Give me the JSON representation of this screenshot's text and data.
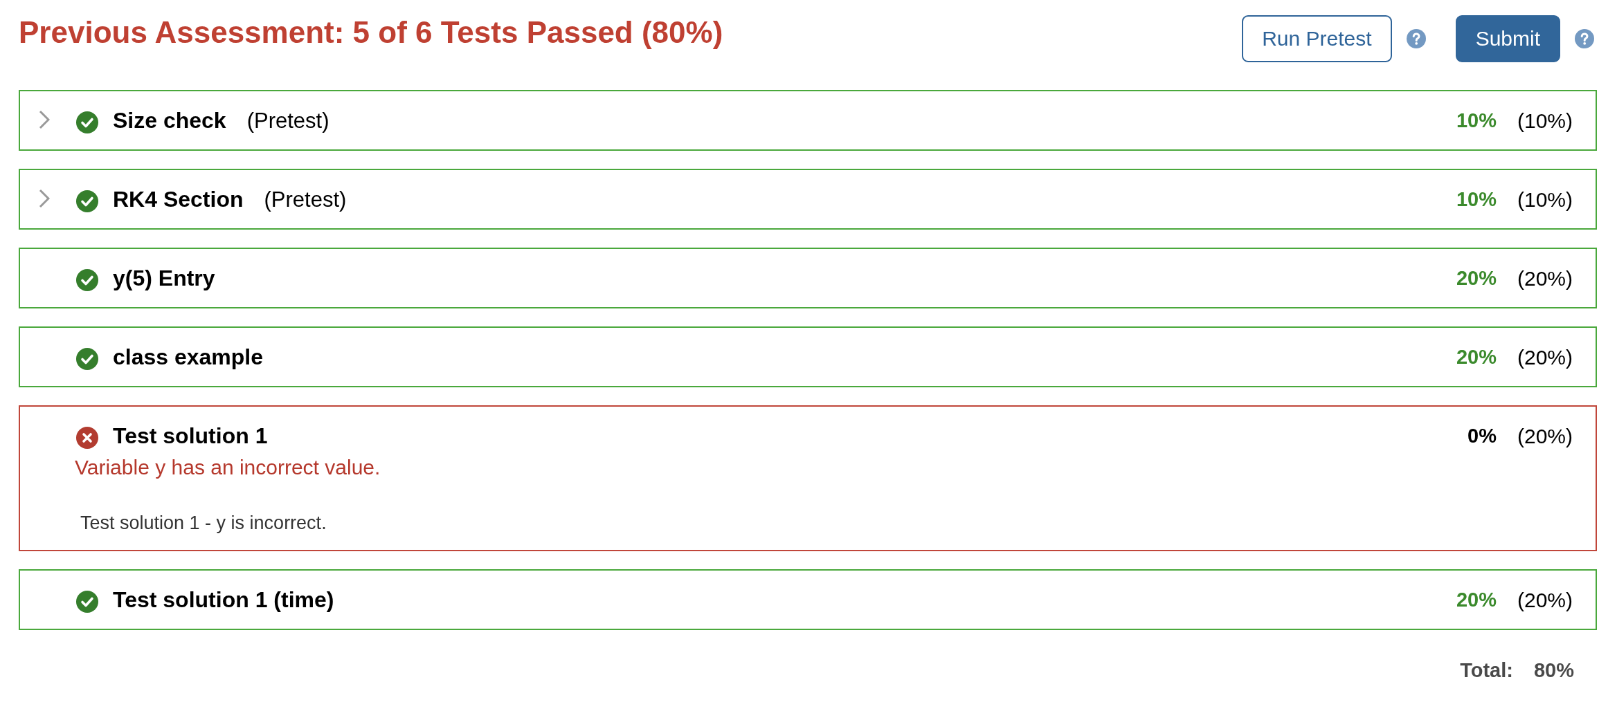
{
  "header": {
    "title": "Previous Assessment: 5 of 6 Tests Passed (80%)",
    "actions": [
      {
        "kind": "outline",
        "label": "Run Pretest",
        "help": true
      },
      {
        "kind": "primary",
        "label": "Submit",
        "help": true
      }
    ]
  },
  "tests": [
    {
      "name": "Size check",
      "tag": "(Pretest)",
      "expandable": true,
      "passed": true,
      "score": "10%",
      "weight": "(10%)"
    },
    {
      "name": "RK4 Section",
      "tag": "(Pretest)",
      "expandable": true,
      "passed": true,
      "score": "10%",
      "weight": "(10%)"
    },
    {
      "name": "y(5) Entry",
      "expandable": false,
      "passed": true,
      "score": "20%",
      "weight": "(20%)"
    },
    {
      "name": "class example",
      "expandable": false,
      "passed": true,
      "score": "20%",
      "weight": "(20%)"
    },
    {
      "name": "Test solution 1",
      "expandable": false,
      "passed": false,
      "score": "0%",
      "weight": "(20%)",
      "message": "Variable y has an incorrect value.",
      "detail": "Test solution 1 - y is incorrect."
    },
    {
      "name": "Test solution 1 (time)",
      "expandable": false,
      "passed": true,
      "score": "20%",
      "weight": "(20%)"
    }
  ],
  "total": {
    "label": "Total:",
    "value": "80%"
  }
}
